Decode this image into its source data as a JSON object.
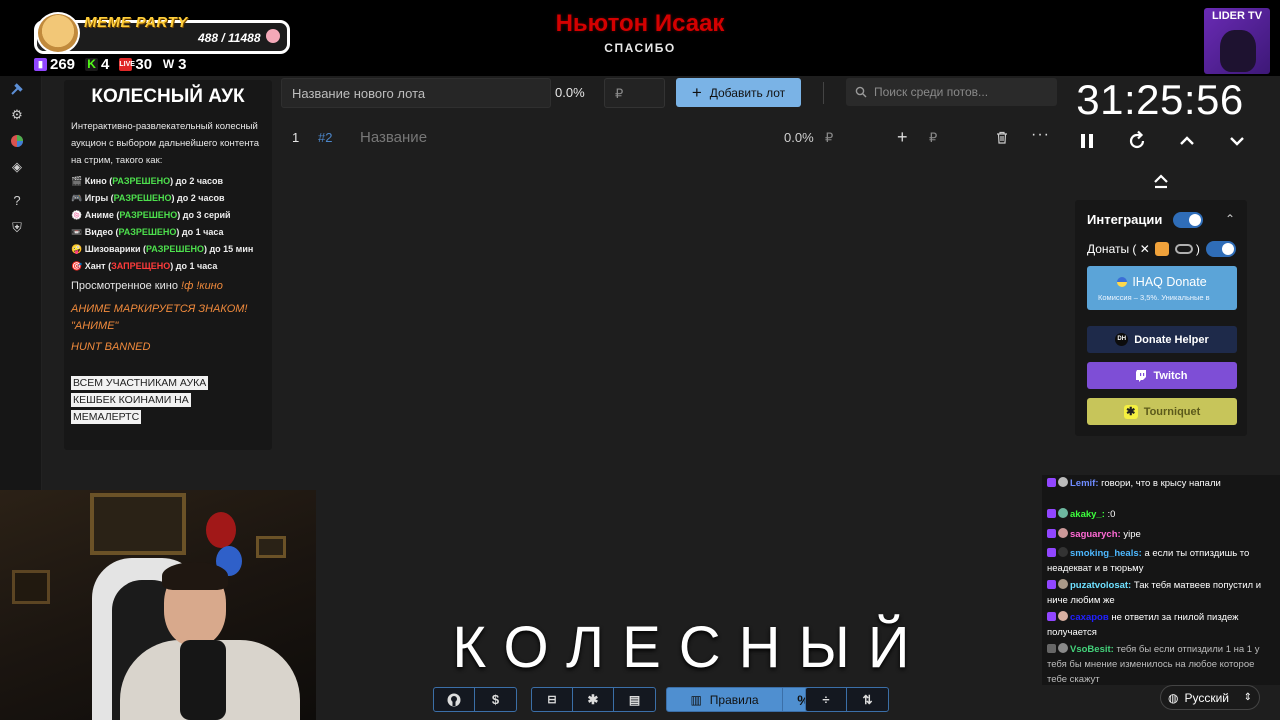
{
  "overlay": {
    "meme_title": "MEME PARTY",
    "meme_counter": "488 / 11488",
    "meme_progress": 0.0425,
    "stats": [
      {
        "icon": "twitch-icon",
        "value": "269",
        "color": "#9146ff"
      },
      {
        "icon": "kick-icon",
        "value": "4",
        "color": "#53fc18"
      },
      {
        "icon": "vk-live-icon",
        "value": "30",
        "color": "#ff3b3b"
      },
      {
        "icon": "w-icon",
        "value": "3",
        "color": "#ffffff"
      }
    ],
    "alert_name": "Ньютон Исаак",
    "alert_sub": "СПАСИБО",
    "channel_badge": "LIDER TV"
  },
  "rules": {
    "title": "КОЛЕСНЫЙ АУК",
    "intro": "Интерактивно-развлекательный колесный аукцион с выбором дальнейшего контента на стрим, такого как:",
    "items": [
      {
        "icon": "🎬",
        "name": "Кино (",
        "status": "РАЗРЕШЕНО",
        "allowed": true,
        "rest": ") до 2 часов"
      },
      {
        "icon": "🎮",
        "name": "Игры (",
        "status": "РАЗРЕШЕНО",
        "allowed": true,
        "rest": ") до 2 часов"
      },
      {
        "icon": "🍥",
        "name": "Аниме (",
        "status": "РАЗРЕШЕНО",
        "allowed": true,
        "rest": ") до 3 серий"
      },
      {
        "icon": "📼",
        "name": "Видео (",
        "status": "РАЗРЕШЕНО",
        "allowed": true,
        "rest": ") до 1 часа"
      },
      {
        "icon": "🤪",
        "name": "Шизоварики (",
        "status": "РАЗРЕШЕНО",
        "allowed": true,
        "rest": ") до 15 мин"
      },
      {
        "icon": "🎯",
        "name": "Хант (",
        "status": "ЗАПРЕЩЕНО",
        "allowed": false,
        "rest": ") до 1 часа"
      }
    ],
    "watched_label": "Просмотренное кино",
    "watched_cmd": "!ф !кино",
    "anime_note": "АНИМЕ МАРКИРУЕТСЯ ЗНАКОМ! \"АНИМЕ\"",
    "hunt_note": "HUNT BANNED",
    "cashback": "ВСЕМ УЧАСТНИКАМ АУКА КЕШБЕК КОИНАМИ НА МЕМАЛЕРТС"
  },
  "lot_form": {
    "name_placeholder": "Название нового лота",
    "percent": "0.0%",
    "amount_placeholder": "₽",
    "add_label": "Добавить лот",
    "search_placeholder": "Поиск среди потов..."
  },
  "lot_row": {
    "index": "1",
    "id": "#2",
    "name": "Название",
    "percent": "0.0%",
    "currency": "₽",
    "add": "+",
    "currency2": "₽",
    "more": "···"
  },
  "timer": {
    "value": "31:25:56"
  },
  "integrations": {
    "title": "Интеграции",
    "donates_label": "Донаты ( ✕",
    "donates_close": ")",
    "ihaq_label": "IHAQ Donate",
    "ihaq_sub": "Комиссия – 3,5%. Уникальные в",
    "donate_helper": "Donate Helper",
    "twitch": "Twitch",
    "tourniquet": "Tourniquet"
  },
  "chat": [
    {
      "user": "Lemif:",
      "color": "#6f8cff",
      "text": " говори, что в крысу напали"
    },
    {
      "user": "akaky_:",
      "color": "#3cff3c",
      "text": " :0"
    },
    {
      "user": "saguarych:",
      "color": "#ff6ad5",
      "text": " yipe"
    },
    {
      "user": "smoking_heals:",
      "color": "#4db8ff",
      "text": " а если ты отпиздишь то неадекват и в тюрьму"
    },
    {
      "user": "puzatvolosat:",
      "color": "#6ee0ff",
      "text": " Так тебя матвеев попустил и ниче любим же"
    },
    {
      "user": "сахаров",
      "color": "#2020ff",
      "text": " не ответил за гнилой пиздеж получается"
    },
    {
      "user": "VsoBesit:",
      "color": "#43d17a",
      "text": " тебя бы если отпиздили 1 на 1 у тебя бы мнение изменилось на любое которое тебе скажут"
    }
  ],
  "caption": "КОЛЕСНЫЙ",
  "toolbar": {
    "rules_label": "Правила",
    "percent_label": "%",
    "dollar_label": "$"
  },
  "language": {
    "label": "Русский"
  },
  "colors": {
    "accent": "#7ab3e6",
    "twitch": "#7e4ed6",
    "alert": "#d40000",
    "toggle": "#2f6db8"
  }
}
